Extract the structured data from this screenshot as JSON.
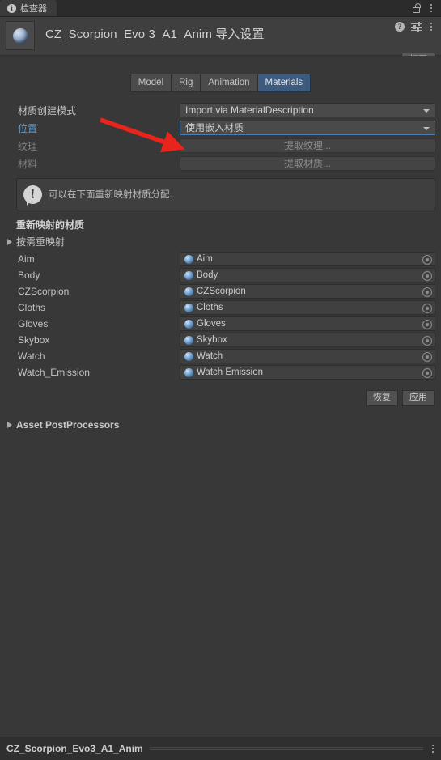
{
  "window": {
    "tab_label": "检查器",
    "info_glyph": "i",
    "lock_icon": "lock-open-icon",
    "menu_icon": "kebab-menu-icon"
  },
  "object_header": {
    "title": "CZ_Scorpion_Evo 3_A1_Anim 导入设置",
    "thumbnail": "model-preview-sphere",
    "help_glyph": "?",
    "open_button": "打开"
  },
  "tabs": [
    {
      "label": "Model",
      "active": false
    },
    {
      "label": "Rig",
      "active": false
    },
    {
      "label": "Animation",
      "active": false
    },
    {
      "label": "Materials",
      "active": true
    }
  ],
  "settings": {
    "creation_mode": {
      "label": "材质创建模式",
      "value": "Import via MaterialDescription"
    },
    "location": {
      "label": "位置",
      "value": "使用嵌入材质"
    },
    "textures": {
      "label": "纹理",
      "button": "提取纹理..."
    },
    "materials": {
      "label": "材料",
      "button": "提取材质..."
    }
  },
  "info_box": {
    "text": "可以在下面重新映射材质分配.",
    "icon": "exclamation-icon"
  },
  "remap": {
    "section_title": "重新映射的材质",
    "foldout_label": "按需重映射",
    "rows": [
      {
        "name": "Aim",
        "material": "Aim"
      },
      {
        "name": "Body",
        "material": "Body"
      },
      {
        "name": "CZScorpion",
        "material": "CZScorpion"
      },
      {
        "name": "Cloths",
        "material": "Cloths"
      },
      {
        "name": "Gloves",
        "material": "Gloves"
      },
      {
        "name": "Skybox",
        "material": "Skybox"
      },
      {
        "name": "Watch",
        "material": "Watch"
      },
      {
        "name": "Watch_Emission",
        "material": "Watch Emission"
      }
    ]
  },
  "actions": {
    "revert": "恢复",
    "apply": "应用"
  },
  "postprocessors": {
    "label": "Asset PostProcessors"
  },
  "footer": {
    "title": "CZ_Scorpion_Evo3_A1_Anim",
    "menu_icon": "kebab-menu-icon"
  },
  "annotation": {
    "arrow_color": "#e8241c"
  },
  "colors": {
    "background": "#383838",
    "panel": "#3f3f3f",
    "accent_selected_tab": "#3d5b7f",
    "link": "#5a9bd5",
    "focus_border": "#4a7fb5"
  }
}
